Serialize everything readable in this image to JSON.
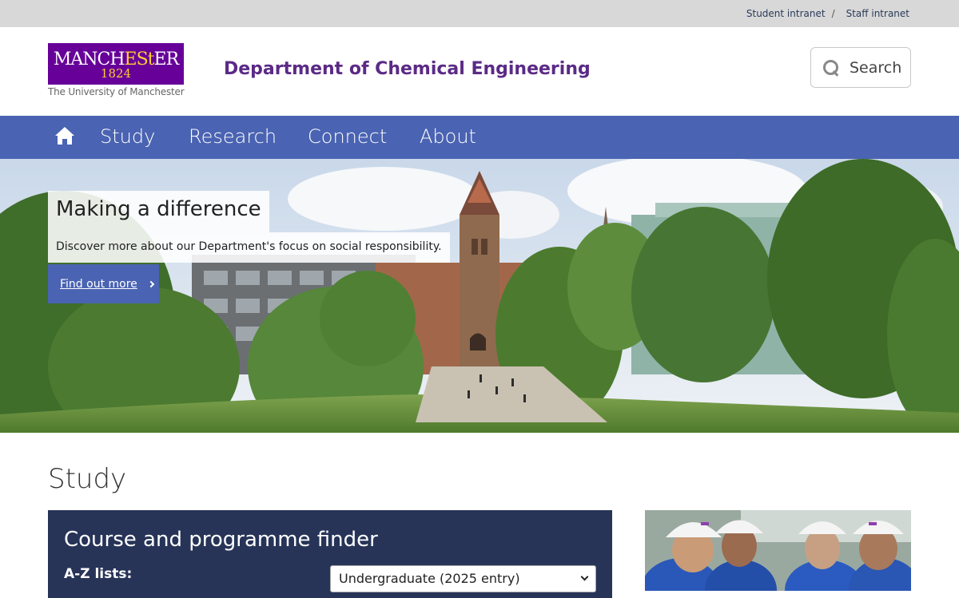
{
  "utility": {
    "links": [
      "Student intranet",
      "Staff intranet"
    ],
    "separator": "/"
  },
  "logo": {
    "word_start": "MANCH",
    "word_est": "ESt",
    "word_end": "ER",
    "year": "1824",
    "subtitle": "The University of Manchester"
  },
  "header": {
    "department": "Department of Chemical Engineering",
    "search_label": "Search"
  },
  "nav": {
    "items": [
      "Study",
      "Research",
      "Connect",
      "About"
    ]
  },
  "hero": {
    "title": "Making a difference",
    "description": "Discover more about our Department's focus on social responsibility.",
    "cta": "Find out more"
  },
  "study": {
    "title": "Study",
    "finder_title": "Course and programme finder",
    "az_label": "A-Z lists:",
    "select_value": "Undergraduate (2025 entry)"
  },
  "colors": {
    "brand_purple": "#660099",
    "nav_blue": "#4a63b2",
    "finder_navy": "#273458",
    "dept_title": "#5b2a86"
  }
}
